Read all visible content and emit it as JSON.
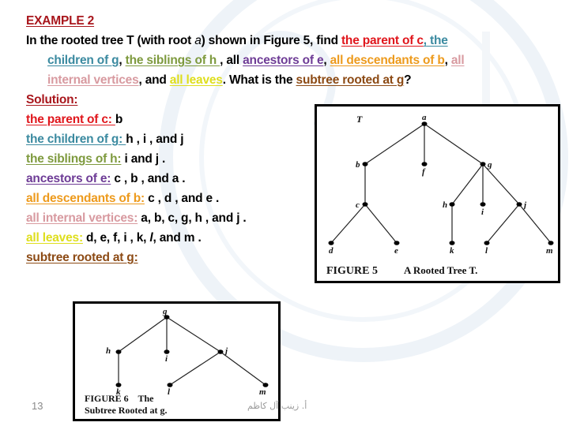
{
  "slide": {
    "title": "EXAMPLE 2",
    "question": {
      "part1": "In the rooted tree T (with root ",
      "root_var": "a",
      "part2": ") shown in Figure 5, find ",
      "q_parent": "the parent of c",
      "sep1": ",",
      "q_children_a": " the",
      "q_children_b": "children of g",
      "sep2": ", ",
      "q_siblings": "the siblings of h ",
      "sep3": ", all ",
      "q_ancestors": "ancestors of e",
      "sep4": ", ",
      "q_descendants": "all descendants of b",
      "sep5": ", ",
      "q_internal_a": "all",
      "q_internal_b": "internal vertices",
      "sep6": ", and ",
      "q_leaves": "all leaves",
      "sep7": ". What is the ",
      "q_subtree": "subtree rooted at g",
      "end": "?"
    },
    "solution_label": "Solution:",
    "answers": [
      {
        "label": "the parent of c: ",
        "value": "b"
      },
      {
        "label": "the children of g: ",
        "value": "h , i , and j"
      },
      {
        "label": "the siblings of h:",
        "value": " i and j ."
      },
      {
        "label": "ancestors of e:",
        "value": " c , b , and a ."
      },
      {
        "label": "all descendants of b:",
        "value": " c , d , and e ."
      },
      {
        "label": "all internal vertices:",
        "value": " a, b, c, g, h , and j ."
      },
      {
        "label": "all leaves:",
        "value_a": " d, e, f, i , k, ",
        "value_l": "l",
        "value_b": ", and m ."
      },
      {
        "label": "subtree rooted at g:"
      }
    ],
    "page_number": "13",
    "author": "أ. زينب آل كاظم"
  },
  "figure5": {
    "tree_label": "T",
    "caption_num": "FIGURE 5",
    "caption_text": "A Rooted Tree T.",
    "nodes": [
      "a",
      "b",
      "f",
      "g",
      "c",
      "h",
      "i",
      "j",
      "d",
      "e",
      "k",
      "l",
      "m"
    ],
    "edges": [
      [
        "a",
        "b"
      ],
      [
        "a",
        "f"
      ],
      [
        "a",
        "g"
      ],
      [
        "b",
        "c"
      ],
      [
        "c",
        "d"
      ],
      [
        "c",
        "e"
      ],
      [
        "g",
        "h"
      ],
      [
        "g",
        "i"
      ],
      [
        "g",
        "j"
      ],
      [
        "h",
        "k"
      ],
      [
        "j",
        "l"
      ],
      [
        "j",
        "m"
      ]
    ]
  },
  "figure6": {
    "caption_line1": "FIGURE 6    The",
    "caption_line2": "Subtree Rooted at g.",
    "nodes": [
      "g",
      "h",
      "i",
      "j",
      "k",
      "l",
      "m"
    ],
    "edges": [
      [
        "g",
        "h"
      ],
      [
        "g",
        "i"
      ],
      [
        "g",
        "j"
      ],
      [
        "h",
        "k"
      ],
      [
        "j",
        "l"
      ],
      [
        "j",
        "m"
      ]
    ]
  }
}
